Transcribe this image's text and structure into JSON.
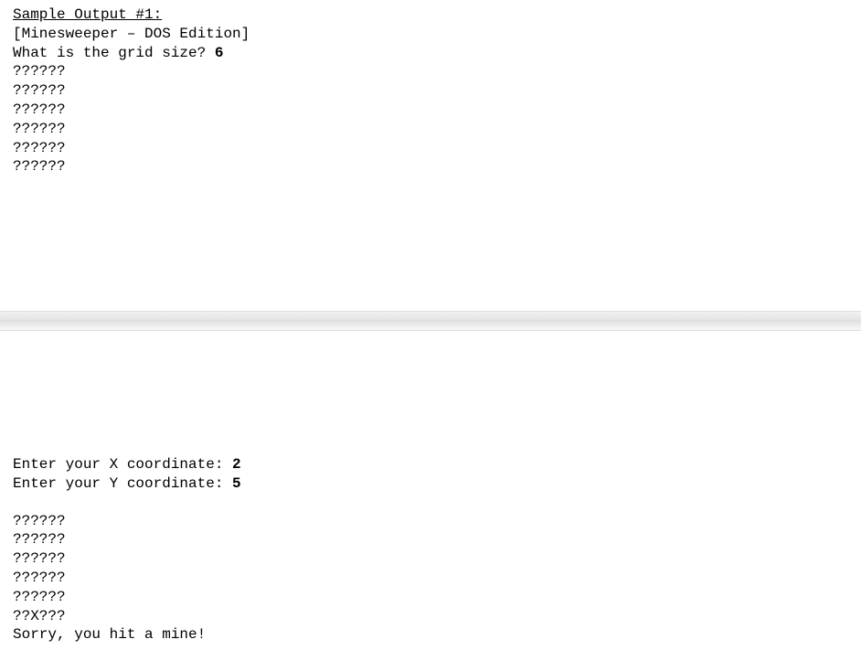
{
  "heading": "Sample Output #1:",
  "title_line": "[Minesweeper – DOS Edition]",
  "grid_prompt_prefix": "What is the grid size? ",
  "grid_prompt_value": "6",
  "grid_initial": [
    "??????",
    "??????",
    "??????",
    "??????",
    "??????",
    "??????"
  ],
  "x_prompt_prefix": "Enter your X coordinate: ",
  "x_prompt_value": "2",
  "y_prompt_prefix": "Enter your Y coordinate: ",
  "y_prompt_value": "5",
  "grid_after": [
    "??????",
    "??????",
    "??????",
    "??????",
    "??????",
    "??X???"
  ],
  "result_line": "Sorry, you hit a mine!"
}
